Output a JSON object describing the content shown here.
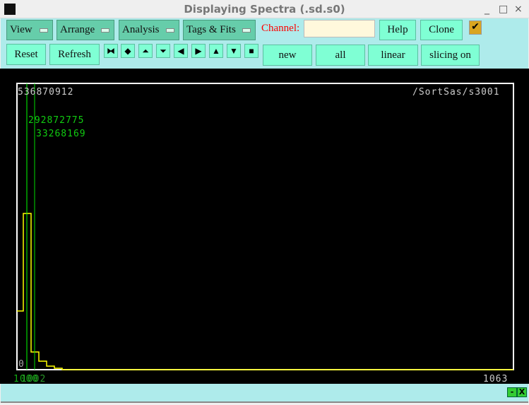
{
  "window": {
    "title": "Displaying Spectra (.sd.s0)",
    "controls": [
      "_",
      "□",
      "×"
    ]
  },
  "toolbar": {
    "menus": [
      "View",
      "Arrange",
      "Analysis",
      "Tags & Fits"
    ],
    "channel_label": "Channel:",
    "channel_value": "",
    "help": "Help",
    "clone": "Clone",
    "checkbox_checked": true,
    "check_glyph": "✔",
    "reset": "Reset",
    "refresh": "Refresh",
    "arrows": [
      "⧓",
      "◆",
      "⏶",
      "⏷",
      "◀",
      "▶",
      "▲",
      "▼",
      "■"
    ],
    "new": "new",
    "all": "all",
    "linear": "linear",
    "slicing": "slicing on"
  },
  "plot": {
    "ymax_label": "536870912",
    "spectrum_name": "/SortSas/s3001",
    "marker_values": [
      "292872775",
      "33268169"
    ],
    "ymin_label": "0",
    "xmax_label": "1063",
    "xmin_labels": [
      "1000",
      "1002"
    ],
    "colors": {
      "trace": "#ffff00",
      "marker": "#00ff00",
      "frame": "#ffffff"
    }
  },
  "statusbar": {
    "min": "-",
    "close": "X"
  }
}
